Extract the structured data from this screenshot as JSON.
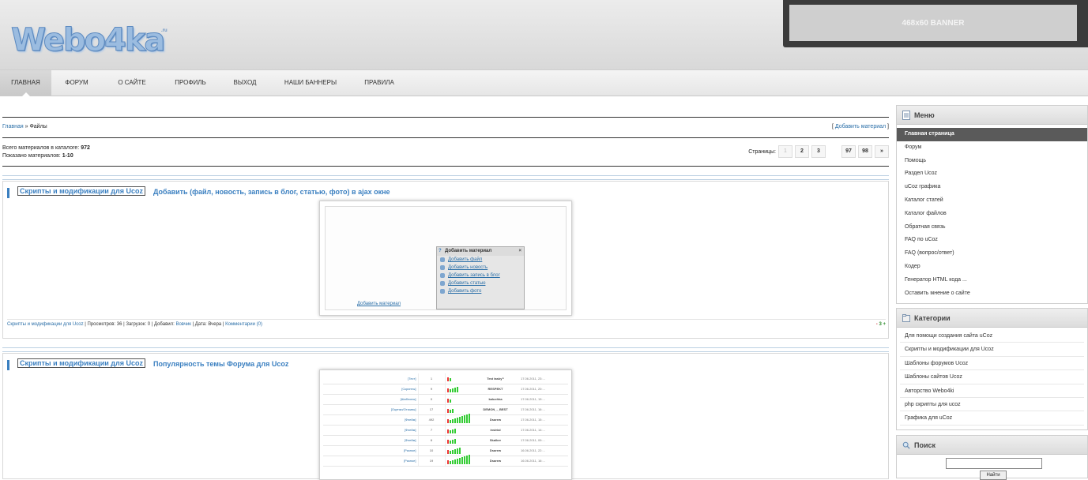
{
  "header": {
    "logo": "Webo4ka",
    "logo_sub": ".ru",
    "banner": "468x60 BANNER"
  },
  "nav": [
    "ГЛАВНАЯ",
    "ФОРУМ",
    "О САЙТЕ",
    "ПРОФИЛЬ",
    "ВЫХОД",
    "НАШИ БАННЕРЫ",
    "ПРАВИЛА"
  ],
  "breadcrumb": {
    "home": "Главная",
    "sep": "»",
    "current": "Файлы"
  },
  "add_material": "Добавить материал",
  "stats": {
    "total_label": "Всего материалов в каталоге:",
    "total": "972",
    "shown_label": "Показано материалов:",
    "shown": "1-10"
  },
  "pager": {
    "label": "Страницы:",
    "pages": [
      "1",
      "2",
      "3",
      "97",
      "98",
      "»"
    ]
  },
  "entries": [
    {
      "category": "Скрипты и модификации для Ucoz",
      "title": "Добавить (файл, новость, запись в блог, статью, фото) в ajax окне",
      "popup": {
        "title": "Добавить материал",
        "links": [
          "Добавить файл",
          "Добавить новость",
          "Добавить запись в блог",
          "Добавить статью",
          "Добавить фото"
        ]
      },
      "shot_link": "Добавить материал",
      "foot": {
        "cat": "Скрипты и модификации для Ucoz",
        "views": "| Просмотров: 36 | Загрузок: 0 | Добавил:",
        "author": "Вовчик",
        "date": "| Дата: Вчера |",
        "comments": "Комментарии (0)",
        "rating": "3"
      }
    },
    {
      "category": "Скрипты и модификации для Ucoz",
      "title": "Популярность темы Форума для Ucoz",
      "rows": [
        {
          "a": "[Тест]",
          "n": "1",
          "u": "Test tasky^",
          "d": "17.06.2011, 23:..."
        },
        {
          "a": "[Скрипты]",
          "n": "9",
          "u": "RESPEKT",
          "d": "17.06.2011, 20:..."
        },
        {
          "a": "[Шаблоны]",
          "n": "0",
          "u": "kaluchka",
          "d": "17.06.2011, 19:..."
        },
        {
          "a": "[Оценки/Отзывы]",
          "n": "17",
          "u": "DEMON_-_BEST",
          "d": "17.06.2011, 16:..."
        },
        {
          "a": "[Флейм]",
          "n": "492",
          "u": "Dsarew",
          "d": "17.06.2011, 15:..."
        },
        {
          "a": "[Флейм]",
          "n": "7",
          "u": "instrial",
          "d": "17.06.2011, 14:..."
        },
        {
          "a": "[Флейм]",
          "n": "6",
          "u": "Skalker",
          "d": "17.06.2011, 09:..."
        },
        {
          "a": "[Разное]",
          "n": "10",
          "u": "Dsarew",
          "d": "16.06.2011, 22:..."
        },
        {
          "a": "[Разное]",
          "n": "19",
          "u": "Dsarew",
          "d": "16.06.2011, 16:..."
        }
      ]
    }
  ],
  "sidebar": {
    "menu_title": "Меню",
    "menu": [
      "Главная страница",
      "Форум",
      "Помощь",
      "Раздел Ucoz",
      "uCoz графика",
      "Каталог статей",
      "Каталог файлов",
      "Обратная связь",
      "FAQ по uCoz",
      "FAQ (вопрос/ответ)",
      "Кодер",
      "Генератор HTML кода ...",
      "Оставить мнение о сайте"
    ],
    "cat_title": "Категории",
    "categories": [
      "Для помощи создания сайта uCoz",
      "Скрипты и модификации для Ucoz",
      "Шаблоны форумов Ucoz",
      "Шаблоны сайтов Ucoz",
      "Авторство Webo4ki",
      "php скрипты для ucoz",
      "Графика для uCoz"
    ],
    "search_title": "Поиск",
    "search_button": "Найти"
  }
}
